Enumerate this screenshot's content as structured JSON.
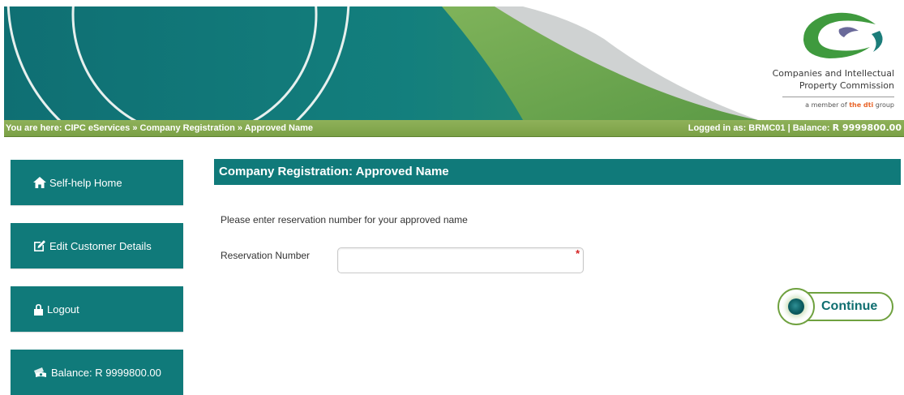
{
  "header": {
    "logo_line1": "Companies and Intellectual",
    "logo_line2": "Property Commission",
    "member_prefix": "a member of ",
    "member_brand": "the dti",
    "member_suffix": " group"
  },
  "breadcrumb": {
    "text": "You are here: CIPC eServices » Company Registration » Approved Name",
    "logged_in_prefix": "Logged in as: BRMC01 | Balance: ",
    "balance": "R 9999800.00"
  },
  "sidebar": {
    "items": [
      {
        "label": "Self-help Home",
        "icon": "home-icon"
      },
      {
        "label": "Edit Customer Details",
        "icon": "edit-icon"
      },
      {
        "label": "Logout",
        "icon": "lock-icon"
      },
      {
        "label": "Balance: R 9999800.00",
        "icon": "money-icon"
      }
    ]
  },
  "main": {
    "title": "Company Registration: Approved Name",
    "instruction": "Please enter reservation number for your approved name",
    "field_label": "Reservation Number",
    "field_value": "",
    "required_mark": "*",
    "continue_label": "Continue"
  },
  "colors": {
    "teal": "#107a7a",
    "green_bar": "#7aa046",
    "required": "#d42020",
    "brand_orange": "#e8652a"
  }
}
